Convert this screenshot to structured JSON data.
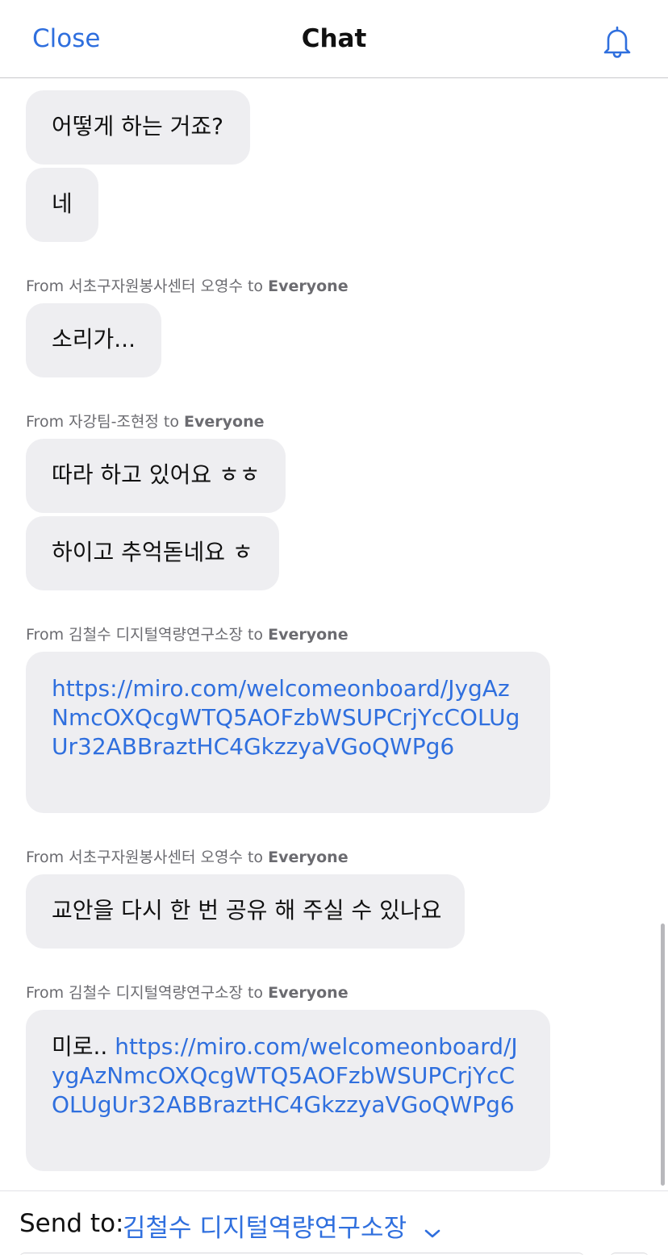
{
  "header": {
    "close_label": "Close",
    "title": "Chat",
    "bell_icon": "bell-icon",
    "accent_color": "#2f6fde"
  },
  "messages": [
    {
      "text": "어떻게 하는 거죠?"
    },
    {
      "text": "네"
    },
    {
      "from_prefix": "From",
      "sender": "서초구자원봉사센터 오영수",
      "to_word": "to",
      "recipient": "Everyone",
      "text": "소리가..."
    },
    {
      "from_prefix": "From",
      "sender": "자강팀-조현정",
      "to_word": "to",
      "recipient": "Everyone",
      "text": "따라 하고 있어요 ㅎㅎ"
    },
    {
      "text": "하이고 추억돋네요 ㅎ"
    },
    {
      "from_prefix": "From",
      "sender": "김철수 디지털역량연구소장",
      "to_word": "to",
      "recipient": "Everyone",
      "link": "https://miro.com/welcomeonboard/JygAzNmcOXQcgWTQ5AOFzbWSUPCrjYcCOLUgUr32ABBraztHC4GkzzyaVGoQWPg6"
    },
    {
      "from_prefix": "From",
      "sender": "서초구자원봉사센터 오영수",
      "to_word": "to",
      "recipient": "Everyone",
      "text": "교안을 다시 한 번 공유 해 주실 수 있나요"
    },
    {
      "from_prefix": "From",
      "sender": "김철수 디지털역량연구소장",
      "to_word": "to",
      "recipient": "Everyone",
      "text_prefix": "미로.. ",
      "link": "https://miro.com/welcomeonboard/JygAzNmcOXQcgWTQ5AOFzbWSUPCrjYcCOLUgUr32ABBraztHC4GkzzyaVGoQWPg6"
    }
  ],
  "footer": {
    "send_to_label": "Send to:",
    "recipient": "김철수 디지털역량연구소장",
    "chevron_icon": "chevron-down-icon"
  }
}
